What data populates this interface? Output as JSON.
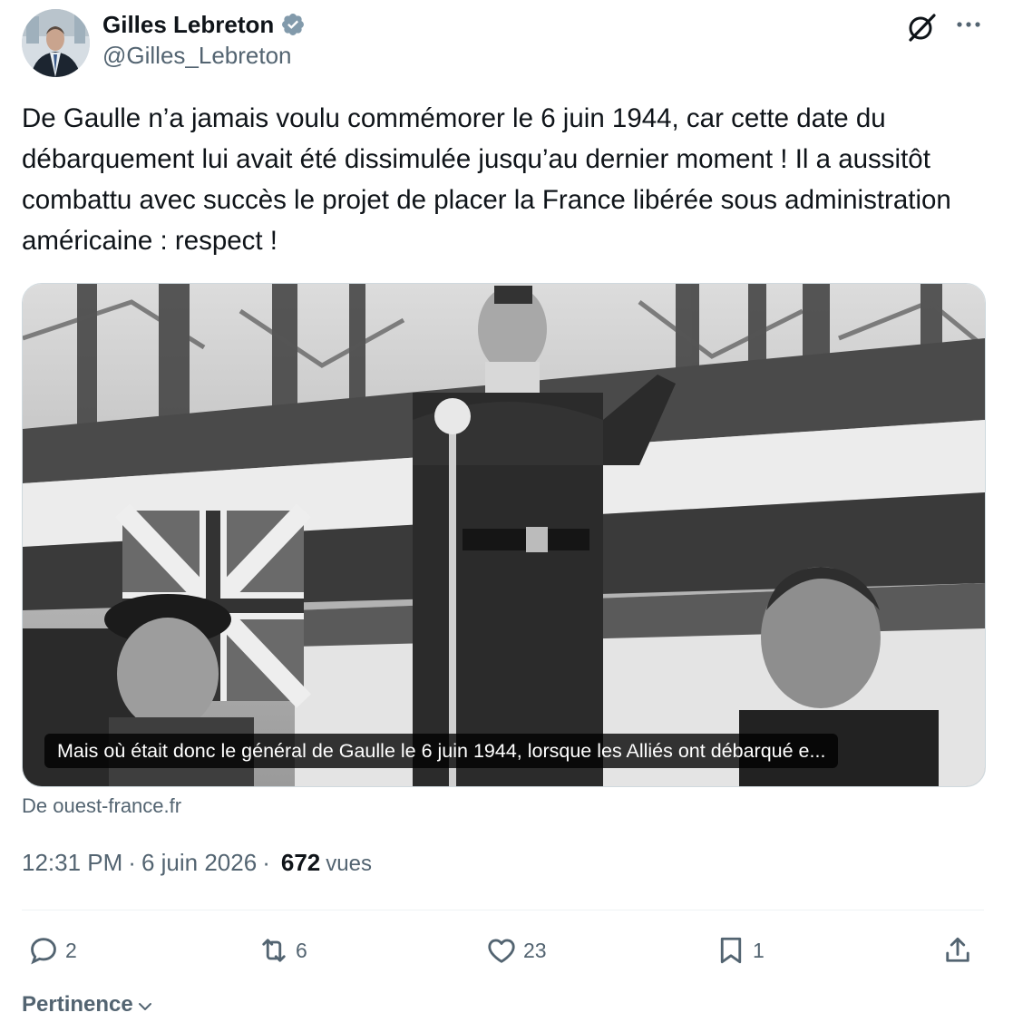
{
  "author": {
    "name": "Gilles Lebreton",
    "handle": "@Gilles_Lebreton",
    "verified_icon": "verified-badge-icon"
  },
  "header_icons": [
    "grok-icon",
    "more-options-icon"
  ],
  "tweet": {
    "text": "De Gaulle n’a jamais voulu commémorer le 6 juin 1944, car cette date du débarquement lui avait été dissimulée jusqu’au dernier moment ! Il a aussitôt combattu avec succès le projet de placer la France libérée sous administration américaine : respect !"
  },
  "link_card": {
    "caption": "Mais où était donc le général de Gaulle le 6 juin 1944, lorsque les Alliés ont débarqué e...",
    "source": "De ouest-france.fr"
  },
  "meta": {
    "time": "12:31 PM",
    "date": "6 juin 2026",
    "views_count": "672",
    "views_label": "vues"
  },
  "actions": {
    "replies": "2",
    "reposts": "6",
    "likes": "23",
    "bookmarks": "1"
  },
  "sort": {
    "label": "Pertinence"
  },
  "colors": {
    "text_primary": "#0f1419",
    "text_secondary": "#536471",
    "verified": "#829aab",
    "divider": "#eff3f4"
  }
}
